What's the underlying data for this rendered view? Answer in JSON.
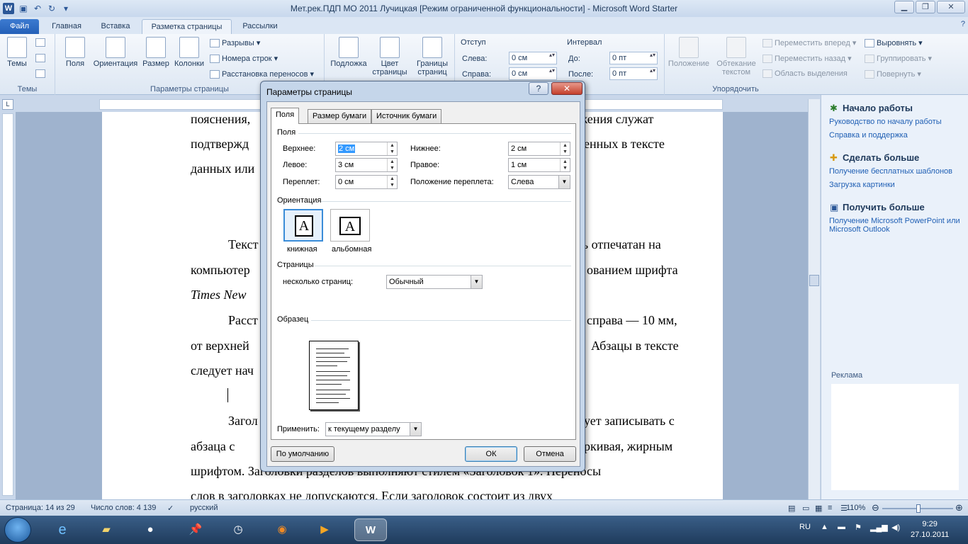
{
  "window": {
    "title": "Мет.рек.ПДП МО  2011 Лучицкая [Режим ограниченной функциональности]  -  Microsoft Word Starter",
    "app_icon": "W",
    "min": "▁",
    "max": "❐",
    "close": "✕"
  },
  "ribbon": {
    "tabs": [
      "Файл",
      "Главная",
      "Вставка",
      "Разметка страницы",
      "Рассылки"
    ],
    "active_tab": "Разметка страницы",
    "help": "?",
    "themes": {
      "label": "Темы",
      "button": "Темы"
    },
    "page_setup": {
      "label": "Параметры страницы",
      "margins": "Поля",
      "orientation": "Ориентация",
      "size": "Размер",
      "columns": "Колонки",
      "breaks": "Разрывы ▾",
      "line_numbers": "Номера строк ▾",
      "hyphenation": "Расстановка переносов ▾"
    },
    "background": {
      "watermark": "Подложка",
      "page_color": "Цвет страницы",
      "page_borders": "Границы страниц"
    },
    "paragraph": {
      "indent": "Отступ",
      "left_label": "Слева:",
      "left_value": "0 см",
      "right_label": "Справа:",
      "right_value": "0 см",
      "spacing": "Интервал",
      "before_label": "До:",
      "before_value": "0 пт",
      "after_label": "После:",
      "after_value": "0 пт"
    },
    "arrange": {
      "label": "Упорядочить",
      "position": "Положение",
      "wrap_text": "Обтекание текстом",
      "bring_forward": "Переместить вперед ▾",
      "send_backward": "Переместить назад ▾",
      "selection_pane": "Область выделения",
      "align": "Выровнять ▾",
      "group": "Группировать ▾",
      "rotate": "Повернуть ▾"
    }
  },
  "document": {
    "lines": [
      "пояснения,",
      "ожения    служат",
      "подтвержд",
      "енных   в   тексте",
      "данных или",
      "Текст",
      "ть   отпечатан   на",
      "компьютер",
      "ованием шрифта",
      "Times New",
      "Расст",
      "справа — 10 мм,",
      "от верхней",
      "Абзацы в тексте",
      "следует нач",
      "Загол",
      "ует   записывать   с",
      "абзаца   с",
      "ркивая,   жирным",
      "шрифтом.  Заголовки  разделов  выполняют  стилем  «Заголовок  1».  Переносы",
      "слов   в   заголовках   не   допускаются.   Если   заголовок   состоит   из   двух"
    ]
  },
  "taskpane": {
    "section1_title": "Начало работы",
    "section1_links": [
      "Руководство по началу работы",
      "Справка и поддержка"
    ],
    "section2_title": "Сделать больше",
    "section2_links": [
      "Получение бесплатных шаблонов",
      "Загрузка картинки"
    ],
    "section3_title": "Получить больше",
    "section3_links": [
      "Получение Microsoft PowerPoint или Microsoft Outlook"
    ],
    "ad_label": "Реклама"
  },
  "statusbar": {
    "page": "Страница: 14 из 29",
    "words": "Число слов: 4 139",
    "language": "русский",
    "zoom": "110%",
    "zoom_out": "⊖",
    "zoom_in": "⊕"
  },
  "taskbar": {
    "lang": "RU",
    "time": "9:29",
    "date": "27.10.2011"
  },
  "dialog": {
    "title": "Параметры страницы",
    "help": "?",
    "close": "✕",
    "tabs": [
      "Поля",
      "Размер бумаги",
      "Источник бумаги"
    ],
    "active_tab": "Поля",
    "margins_section": "Поля",
    "top_label": "Верхнее:",
    "top_value": "2 см",
    "bottom_label": "Нижнее:",
    "bottom_value": "2 см",
    "left_label": "Левое:",
    "left_value": "3 см",
    "right_label": "Правое:",
    "right_value": "1 см",
    "gutter_label": "Переплет:",
    "gutter_value": "0 см",
    "gutter_pos_label": "Положение переплета:",
    "gutter_pos_value": "Слева",
    "orientation_section": "Ориентация",
    "portrait_label": "книжная",
    "landscape_label": "альбомная",
    "orientation_glyph": "A",
    "pages_section": "Страницы",
    "multiple_pages_label": "несколько страниц:",
    "multiple_pages_value": "Обычный",
    "preview_section": "Образец",
    "apply_label": "Применить:",
    "apply_value": "к текущему разделу",
    "default_button": "По умолчанию",
    "ok_button": "ОК",
    "cancel_button": "Отмена"
  }
}
